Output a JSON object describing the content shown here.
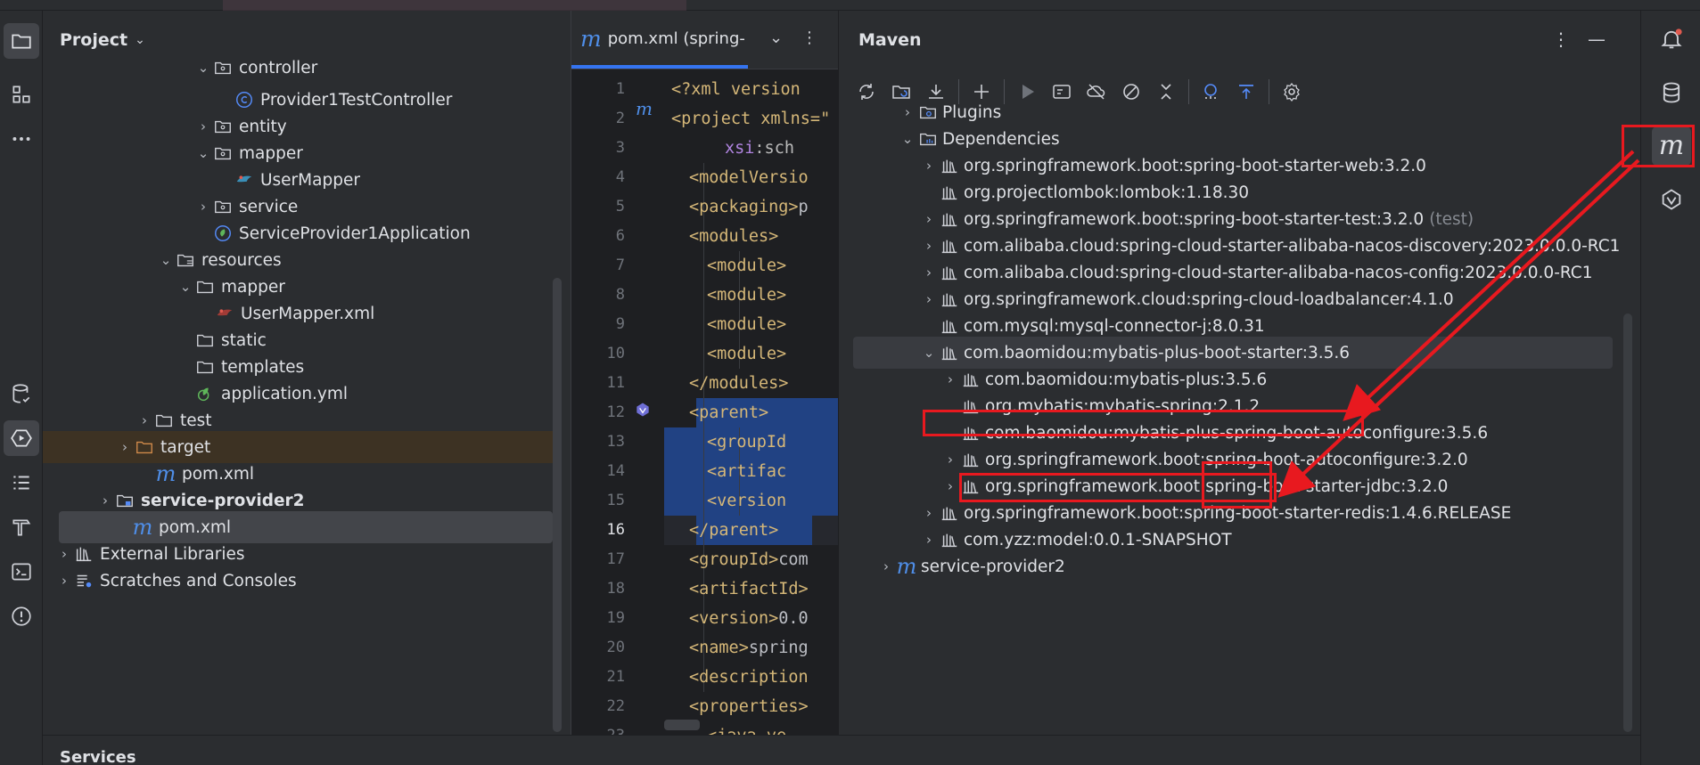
{
  "project": {
    "title": "Project",
    "rows": [
      {
        "label": "controller"
      },
      {
        "label": "Provider1TestController"
      },
      {
        "label": "entity"
      },
      {
        "label": "mapper"
      },
      {
        "label": "UserMapper"
      },
      {
        "label": "service"
      },
      {
        "label": "ServiceProvider1Application"
      },
      {
        "label": "resources"
      },
      {
        "label": "mapper"
      },
      {
        "label": "UserMapper.xml"
      },
      {
        "label": "static"
      },
      {
        "label": "templates"
      },
      {
        "label": "application.yml"
      },
      {
        "label": "test"
      },
      {
        "label": "target"
      },
      {
        "label": "pom.xml"
      },
      {
        "label": "service-provider2"
      },
      {
        "label": "pom.xml"
      },
      {
        "label": "External Libraries"
      },
      {
        "label": "Scratches and Consoles"
      }
    ]
  },
  "editor": {
    "tab_label": "pom.xml (spring-",
    "line_numbers": [
      "1",
      "2",
      "3",
      "4",
      "5",
      "6",
      "7",
      "8",
      "9",
      "10",
      "11",
      "12",
      "13",
      "14",
      "15",
      "16",
      "17",
      "18",
      "19",
      "20",
      "21",
      "22",
      "23"
    ],
    "lines": [
      {
        "tag": "<?xml version",
        "rest": ""
      },
      {
        "tag": "<project xmlns=\"",
        "rest": ""
      },
      {
        "tag": "",
        "rest": "xsi:sch"
      },
      {
        "tag": "<modelVersio",
        "rest": ""
      },
      {
        "tag": "<packaging>",
        "rest": "p"
      },
      {
        "tag": "<modules>",
        "rest": ""
      },
      {
        "tag": "<module>",
        "rest": ""
      },
      {
        "tag": "<module>",
        "rest": ""
      },
      {
        "tag": "<module>",
        "rest": ""
      },
      {
        "tag": "<module>",
        "rest": ""
      },
      {
        "tag": "</modules>",
        "rest": ""
      },
      {
        "tag": "<parent>",
        "rest": ""
      },
      {
        "tag": "<groupId",
        "rest": ""
      },
      {
        "tag": "<artifac",
        "rest": ""
      },
      {
        "tag": "<version",
        "rest": ""
      },
      {
        "tag": "</parent>",
        "rest": ""
      },
      {
        "tag": "<groupId>",
        "rest": "com"
      },
      {
        "tag": "<artifactId>",
        "rest": ""
      },
      {
        "tag": "<version>",
        "rest": "0.0"
      },
      {
        "tag": "<name>",
        "rest": "spring"
      },
      {
        "tag": "<description",
        "rest": ""
      },
      {
        "tag": "<properties>",
        "rest": ""
      },
      {
        "tag": "<java.ve",
        "rest": ""
      }
    ]
  },
  "maven": {
    "title": "Maven",
    "rows": [
      {
        "label": "Plugins",
        "muted": ""
      },
      {
        "label": "Dependencies",
        "muted": ""
      },
      {
        "label": "org.springframework.boot:spring-boot-starter-web:3.2.0",
        "muted": ""
      },
      {
        "label": "org.projectlombok:lombok:1.18.30",
        "muted": ""
      },
      {
        "label": "org.springframework.boot:spring-boot-starter-test:3.2.0",
        "muted": "(test)"
      },
      {
        "label": "com.alibaba.cloud:spring-cloud-starter-alibaba-nacos-discovery:2023.0.0.0-RC1",
        "muted": ""
      },
      {
        "label": "com.alibaba.cloud:spring-cloud-starter-alibaba-nacos-config:2023.0.0.0-RC1",
        "muted": ""
      },
      {
        "label": "org.springframework.cloud:spring-cloud-loadbalancer:4.1.0",
        "muted": ""
      },
      {
        "label": "com.mysql:mysql-connector-j:8.0.31",
        "muted": ""
      },
      {
        "label": "com.baomidou:mybatis-plus-boot-starter:3.5.6",
        "muted": ""
      },
      {
        "label": "com.baomidou:mybatis-plus:3.5.6",
        "muted": ""
      },
      {
        "label": "org.mybatis:mybatis-spring:2.1.2",
        "muted": ""
      },
      {
        "label": "com.baomidou:mybatis-plus-spring-boot-autoconfigure:3.5.6",
        "muted": ""
      },
      {
        "label": "org.springframework.boot:spring-boot-autoconfigure:3.2.0",
        "muted": ""
      },
      {
        "label": "org.springframework.boot:spring-boot-starter-jdbc:3.2.0",
        "muted": ""
      },
      {
        "label": "org.springframework.boot:spring-boot-starter-redis:1.4.6.RELEASE",
        "muted": ""
      },
      {
        "label": "com.yzz:model:0.0.1-SNAPSHOT",
        "muted": ""
      },
      {
        "label": "service-provider2",
        "muted": ""
      }
    ]
  },
  "bottom": {
    "title": "Services"
  },
  "colors": {
    "accent_blue": "#3574f0",
    "annotation_red": "#e8191f",
    "xml_tag": "#d5b778"
  }
}
